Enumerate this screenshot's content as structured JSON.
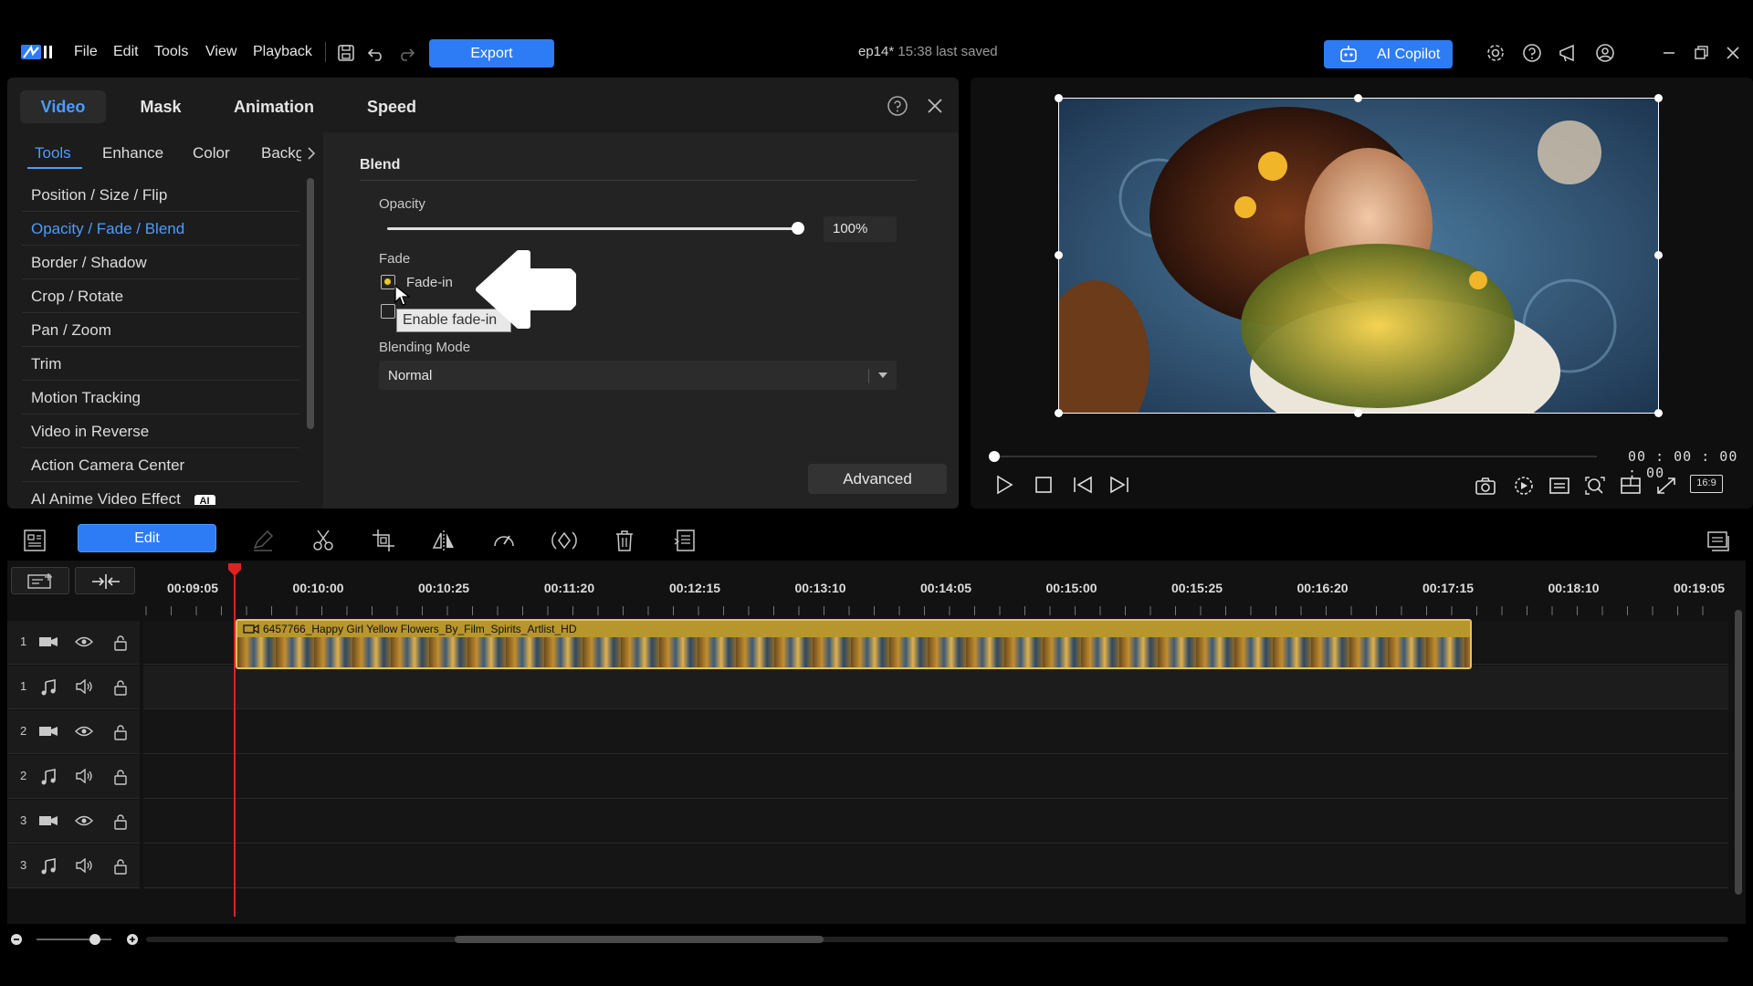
{
  "menu": {
    "file": "File",
    "edit": "Edit",
    "tools": "Tools",
    "view": "View",
    "playback": "Playback"
  },
  "export_label": "Export",
  "doc": {
    "name": "ep14*",
    "saved": "15:38 last saved"
  },
  "copilot_label": "AI Copilot",
  "panel": {
    "tabs": [
      "Video",
      "Mask",
      "Animation",
      "Speed"
    ],
    "subtabs": [
      "Tools",
      "Enhance",
      "Color",
      "Backg"
    ],
    "tools": [
      "Position / Size / Flip",
      "Opacity / Fade / Blend",
      "Border / Shadow",
      "Crop / Rotate",
      "Pan / Zoom",
      "Trim",
      "Motion Tracking",
      "Video in Reverse",
      "Action Camera Center",
      "AI Anime Video Effect"
    ],
    "ai_badge": "AI",
    "blend_title": "Blend",
    "opacity_label": "Opacity",
    "opacity_value": "100%",
    "opacity_level": 1.0,
    "fade_label": "Fade",
    "fade_in_label": "Fade-in",
    "tooltip": "Enable fade-in",
    "blending_mode_label": "Blending Mode",
    "blending_mode_value": "Normal",
    "advanced_label": "Advanced"
  },
  "preview": {
    "timecode": "00 : 00 : 00 : 00",
    "aspect": "16:9",
    "progress": 0.0
  },
  "toolbar": {
    "edit_label": "Edit"
  },
  "timeline": {
    "ticks": [
      "00:09:05",
      "00:10:00",
      "00:10:25",
      "00:11:20",
      "00:12:15",
      "00:13:10",
      "00:14:05",
      "00:15:00",
      "00:15:25",
      "00:16:20",
      "00:17:15",
      "00:18:10",
      "00:19:05"
    ],
    "tracks": [
      {
        "num": "1",
        "type": "video"
      },
      {
        "num": "1",
        "type": "audio"
      },
      {
        "num": "2",
        "type": "video"
      },
      {
        "num": "2",
        "type": "audio"
      },
      {
        "num": "3",
        "type": "video"
      },
      {
        "num": "3",
        "type": "audio"
      }
    ],
    "clip_title": "6457766_Happy Girl Yellow Flowers_By_Film_Spirits_Artlist_HD"
  },
  "colors": {
    "accent": "#2d7cf6",
    "link": "#4d9bff",
    "playhead": "#dd2222",
    "clip_border": "#e6c25a"
  }
}
